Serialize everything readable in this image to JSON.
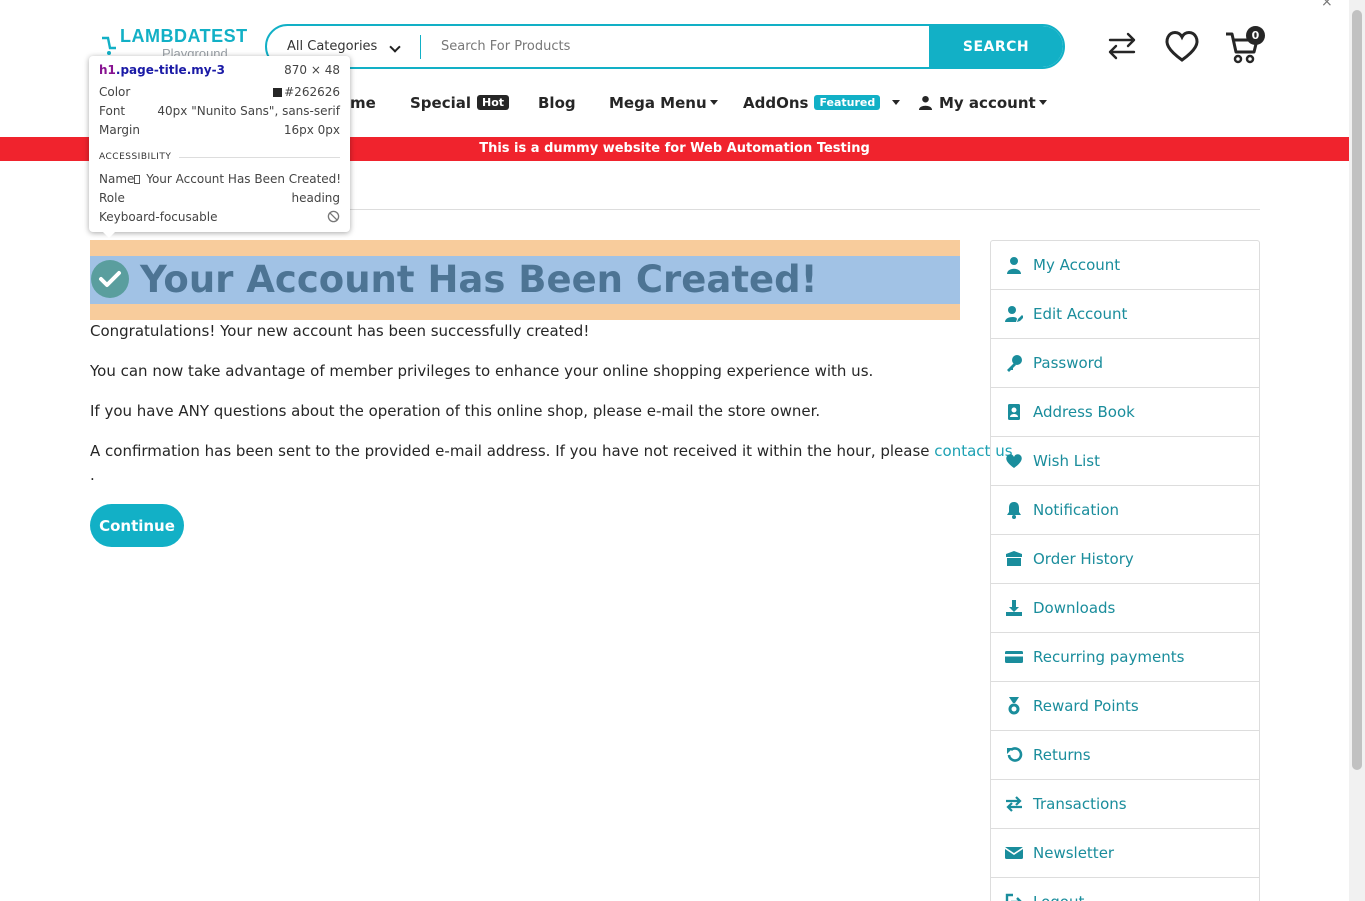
{
  "header": {
    "logo_text": "LAMBDATEST",
    "logo_sub": "Playground",
    "category_label": "All Categories",
    "search_placeholder": "Search For Products",
    "search_button": "SEARCH",
    "cart_count": "0",
    "close_label": "×"
  },
  "nav": {
    "home": "me",
    "special": "Special",
    "special_badge": "Hot",
    "blog": "Blog",
    "mega_menu": "Mega Menu",
    "addons": "AddOns",
    "addons_badge": "Featured",
    "my_account": "My account"
  },
  "banner": "This is a dummy website for Web Automation Testing",
  "main": {
    "title": "Your Account Has Been Created!",
    "p1": "Congratulations! Your new account has been successfully created!",
    "p2": "You can now take advantage of member privileges to enhance your online shopping experience with us.",
    "p3": "If you have ANY questions about the operation of this online shop, please e-mail the store owner.",
    "p4_text": "A confirmation has been sent to the provided e-mail address. If you have not received it within the hour, please ",
    "p4_link": "contact us",
    "p4_end": ".",
    "continue_label": "Continue"
  },
  "sidebar": {
    "items": [
      {
        "label": "My Account",
        "icon": "user-icon"
      },
      {
        "label": "Edit Account",
        "icon": "user-edit-icon"
      },
      {
        "label": "Password",
        "icon": "key-icon"
      },
      {
        "label": "Address Book",
        "icon": "address-book-icon"
      },
      {
        "label": "Wish List",
        "icon": "heart-icon"
      },
      {
        "label": "Notification",
        "icon": "bell-icon"
      },
      {
        "label": "Order History",
        "icon": "box-icon"
      },
      {
        "label": "Downloads",
        "icon": "download-icon"
      },
      {
        "label": "Recurring payments",
        "icon": "credit-card-icon"
      },
      {
        "label": "Reward Points",
        "icon": "medal-icon"
      },
      {
        "label": "Returns",
        "icon": "undo-icon"
      },
      {
        "label": "Transactions",
        "icon": "exchange-icon"
      },
      {
        "label": "Newsletter",
        "icon": "envelope-icon"
      },
      {
        "label": "Logout",
        "icon": "logout-icon"
      }
    ]
  },
  "devtools_tooltip": {
    "selector_tag": "h1",
    "selector_class": ".page-title.my-3",
    "size": "870 × 48",
    "color_label": "Color",
    "color_value": "#262626",
    "font_label": "Font",
    "font_value": "40px \"Nunito Sans\", sans-serif",
    "margin_label": "Margin",
    "margin_value": "16px 0px",
    "accessibility_heading": "ACCESSIBILITY",
    "name_label": "Name",
    "name_value": " Your Account Has Been Created!",
    "role_label": "Role",
    "role_value": "heading",
    "focus_label": "Keyboard-focusable"
  },
  "colors": {
    "accent": "#12b0c6",
    "link": "#1a8d9c",
    "banner": "#f0232d",
    "highlight_margin": "#f8cc9c",
    "highlight_content": "#a1c2e5",
    "text": "#262626"
  }
}
